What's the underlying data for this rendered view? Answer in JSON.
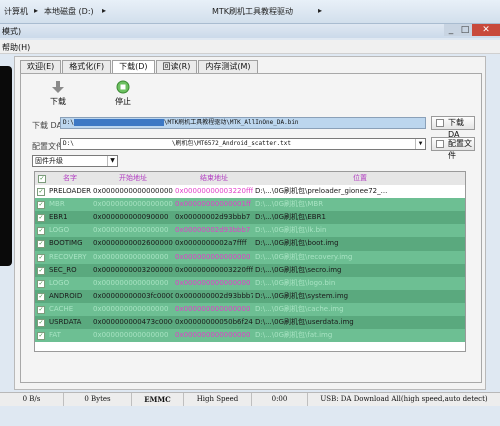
{
  "breadcrumb": {
    "computer": "计算机",
    "disk": "本地磁盘 (D:)",
    "folder": "MTK刷机工具教程驱动"
  },
  "window": {
    "title_frag": "模式)",
    "close": "✕",
    "menu": "帮助(H)"
  },
  "tabs": [
    {
      "label": "欢迎(E)"
    },
    {
      "label": "格式化(F)"
    },
    {
      "label": "下载(D)"
    },
    {
      "label": "回读(R)"
    },
    {
      "label": "内存测试(M)"
    }
  ],
  "toolbar": {
    "download": "下载",
    "stop": "停止"
  },
  "download_agent": {
    "label": "下载 DA",
    "path_prefix": "D:\\",
    "path_rest": "\\MTK刷机工具教程驱动\\MTK_AllInOne_DA.bin",
    "button": "下载 DA"
  },
  "scatter": {
    "label": "配置文件",
    "path_prefix": "D:\\",
    "path_rest": "\\刷机包\\MT6572_Android_scatter.txt",
    "button": "配置文件"
  },
  "mode": {
    "selected": "固件升级"
  },
  "table": {
    "headers": [
      "名字",
      "开始地址",
      "结束地址",
      "位置"
    ],
    "rows": [
      {
        "name": "PRELOADER",
        "start": "0x0000000000000000",
        "end": "0x00000000003220fff",
        "loc": "D:\\...\\0G刷机包\\preloader_gionee72_...",
        "checked": true,
        "style": "rw"
      },
      {
        "name": "MBR",
        "start": "0x0000000000000000",
        "end": "0x00000000000001ff",
        "loc": "D:\\...\\0G刷机包\\MBR",
        "checked": true,
        "style": "rf"
      },
      {
        "name": "EBR1",
        "start": "0x000000000090000",
        "end": "0x00000002d93bbb7",
        "loc": "D:\\...\\0G刷机包\\EBR1",
        "checked": true,
        "style": "rg"
      },
      {
        "name": "LOGO",
        "start": "0x000000000000000",
        "end": "0x00000002d93bbb7",
        "loc": "D:\\...\\0G刷机包\\lk.bin",
        "checked": true,
        "style": "rf"
      },
      {
        "name": "BOOTIMG",
        "start": "0x0000000002600000",
        "end": "0x0000000002a7ffff",
        "loc": "D:\\...\\0G刷机包\\boot.img",
        "checked": true,
        "style": "rg"
      },
      {
        "name": "RECOVERY",
        "start": "0x000000000000000",
        "end": "0x000000000000000",
        "loc": "D:\\...\\0G刷机包\\recovery.img",
        "checked": true,
        "style": "rf"
      },
      {
        "name": "SEC_RO",
        "start": "0x0000000003200000",
        "end": "0x00000000003220fff",
        "loc": "D:\\...\\0G刷机包\\secro.img",
        "checked": true,
        "style": "rg"
      },
      {
        "name": "LOGO",
        "start": "0x000000000000000",
        "end": "0x000000000000000",
        "loc": "D:\\...\\0G刷机包\\logo.bin",
        "checked": true,
        "style": "rf"
      },
      {
        "name": "ANDROID",
        "start": "0x00000000003fc0000",
        "end": "0x000000002d93bbb7",
        "loc": "D:\\...\\0G刷机包\\system.img",
        "checked": true,
        "style": "rg"
      },
      {
        "name": "CACHE",
        "start": "0x000000000000000",
        "end": "0x000000000000000",
        "loc": "D:\\...\\0G刷机包\\cache.img",
        "checked": true,
        "style": "rf"
      },
      {
        "name": "USRDATA",
        "start": "0x000000000473c0000",
        "end": "0x00000000050b6f24f",
        "loc": "D:\\...\\0G刷机包\\userdata.img",
        "checked": true,
        "style": "rg"
      },
      {
        "name": "FAT",
        "start": "0x000000000000000",
        "end": "0x000000000000000",
        "loc": "D:\\...\\0G刷机包\\fat.img",
        "checked": true,
        "style": "rf"
      }
    ]
  },
  "status": {
    "speed": "0 B/s",
    "bytes": "0 Bytes",
    "storage": "EMMC",
    "usb": "High Speed",
    "time": "0:00",
    "mode": "USB: DA Download All(high speed,auto detect)"
  },
  "colors": {
    "row_green": "#5aa97e",
    "row_faded": "#6dbf93",
    "header_text": "#b23dc2"
  }
}
